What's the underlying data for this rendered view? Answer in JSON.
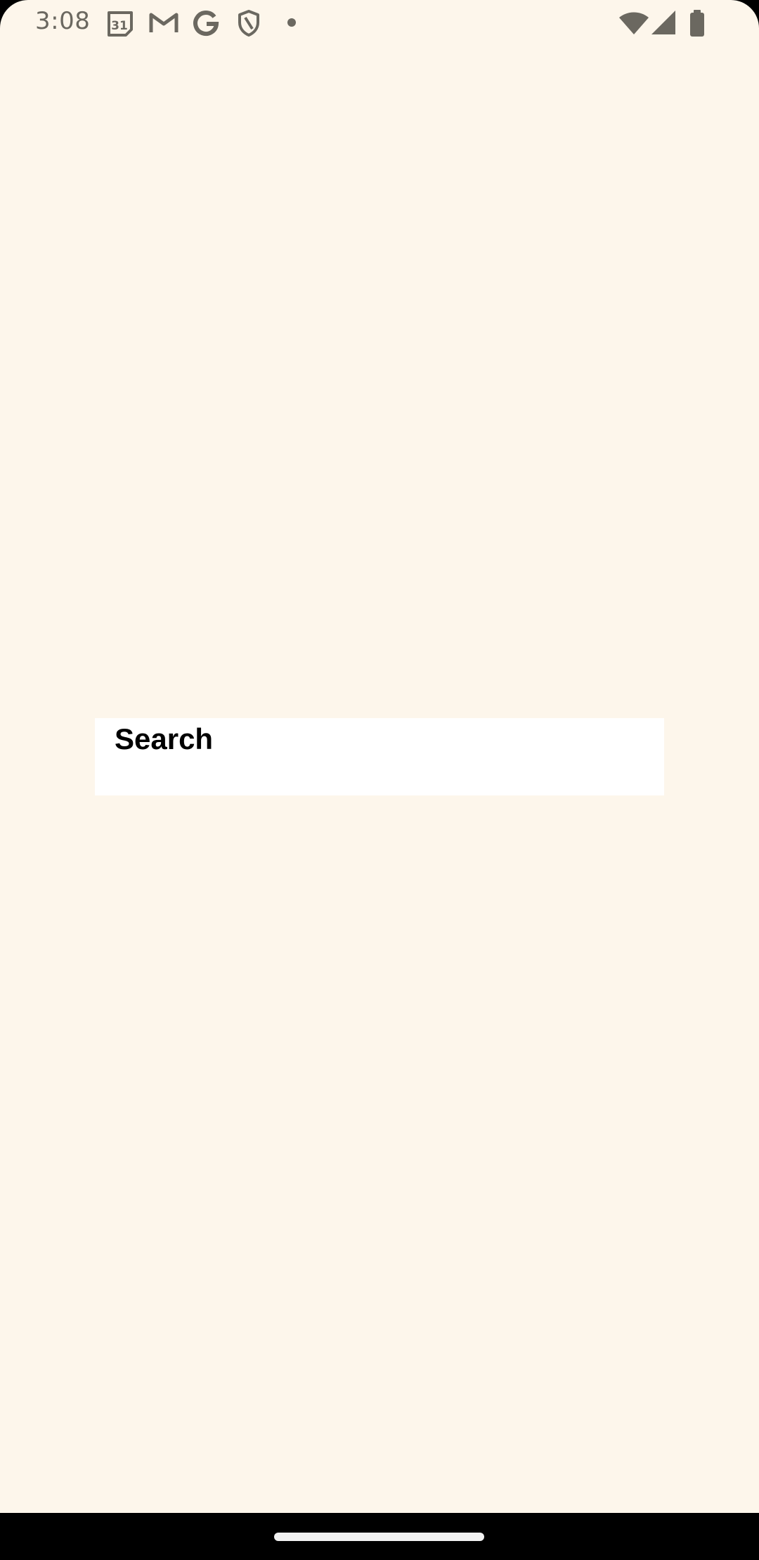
{
  "status_bar": {
    "time": "3:08",
    "calendar_day": "31",
    "notification_icons": [
      "calendar-icon",
      "gmail-icon",
      "google-icon",
      "shield-icon",
      "dot-icon"
    ],
    "system_icons": [
      "wifi-icon",
      "signal-icon",
      "battery-icon"
    ],
    "icon_color": "#6b6860"
  },
  "search": {
    "label": "Search"
  },
  "colors": {
    "background": "#fdf6eb",
    "search_box": "#ffffff",
    "nav_bar": "#000000"
  }
}
